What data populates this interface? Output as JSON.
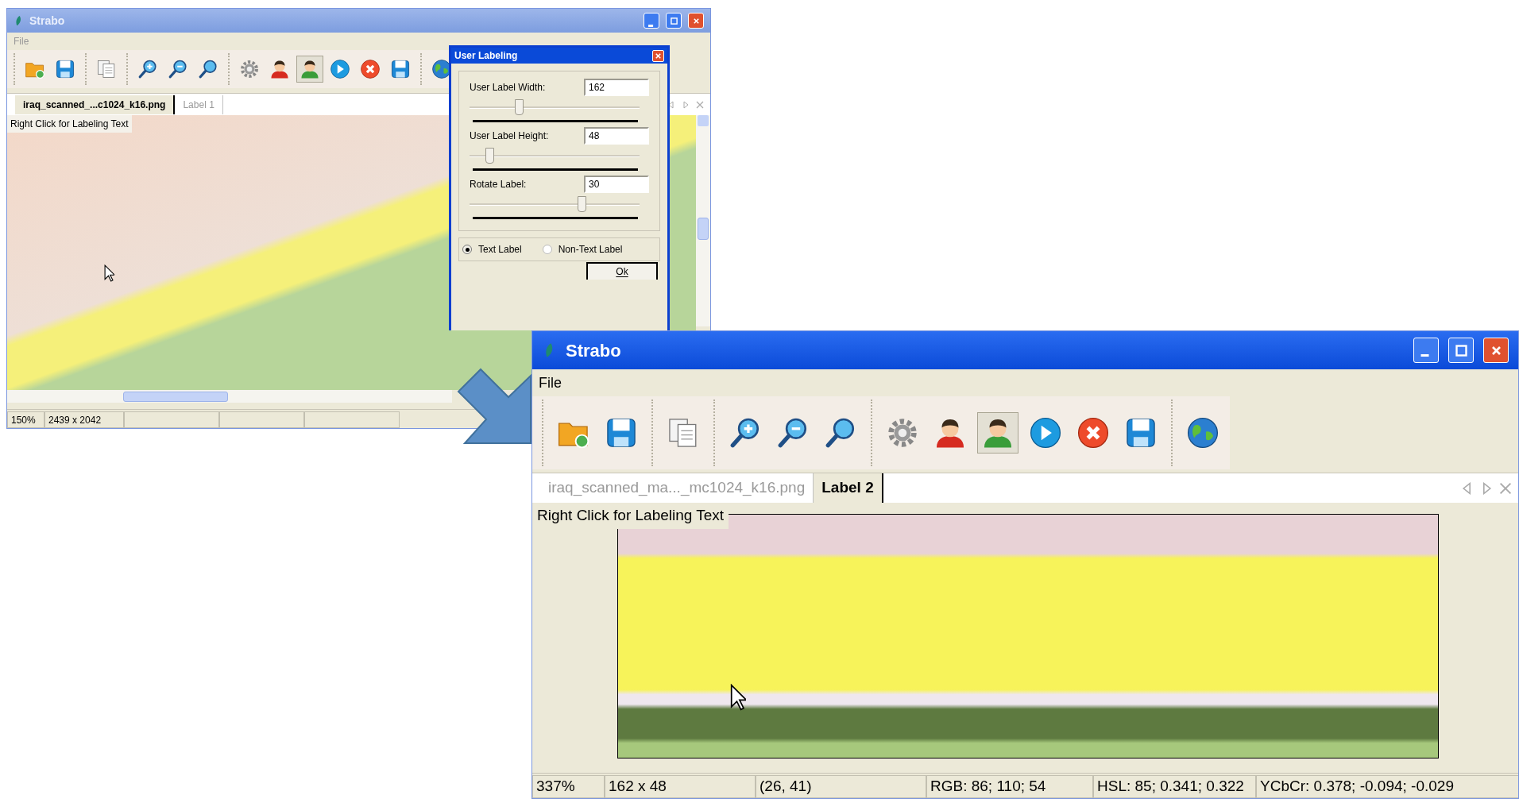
{
  "windows": [
    {
      "title": "Strabo",
      "active": false,
      "menu": [
        "File"
      ],
      "toolbar": [
        [
          {
            "kind": "open",
            "pressed": false
          },
          {
            "kind": "save",
            "pressed": false
          }
        ],
        [
          {
            "kind": "copy",
            "pressed": false
          }
        ],
        [
          {
            "kind": "zoom_in",
            "pressed": false
          },
          {
            "kind": "zoom_out",
            "pressed": false
          },
          {
            "kind": "zoom_fit",
            "pressed": false
          }
        ],
        [
          {
            "kind": "settings",
            "pressed": false
          },
          {
            "kind": "person_red",
            "pressed": false
          },
          {
            "kind": "person_green",
            "pressed": true
          },
          {
            "kind": "play",
            "pressed": false
          },
          {
            "kind": "cancel",
            "pressed": false
          },
          {
            "kind": "save",
            "pressed": false
          }
        ],
        [
          {
            "kind": "globe",
            "pressed": false
          }
        ]
      ],
      "tabs": [
        {
          "label": "iraq_scanned_...c1024_k16.png",
          "selected": true
        },
        {
          "label": "Label 1",
          "selected": false
        }
      ],
      "caption": "Right Click for Labeling Text",
      "status_bar": [
        "150%",
        "2439 x 2042"
      ]
    },
    {
      "title": "Strabo",
      "active": true,
      "menu": [
        "File"
      ],
      "toolbar": [
        [
          {
            "kind": "open",
            "pressed": false
          },
          {
            "kind": "save",
            "pressed": false
          }
        ],
        [
          {
            "kind": "copy",
            "pressed": false
          }
        ],
        [
          {
            "kind": "zoom_in",
            "pressed": false
          },
          {
            "kind": "zoom_out",
            "pressed": false
          },
          {
            "kind": "zoom_fit",
            "pressed": false
          }
        ],
        [
          {
            "kind": "settings",
            "pressed": false
          },
          {
            "kind": "person_red",
            "pressed": false
          },
          {
            "kind": "person_green",
            "pressed": true
          },
          {
            "kind": "play",
            "pressed": false
          },
          {
            "kind": "cancel",
            "pressed": false
          },
          {
            "kind": "save",
            "pressed": false
          }
        ],
        [
          {
            "kind": "globe",
            "pressed": false
          }
        ]
      ],
      "tabs": [
        {
          "label": "iraq_scanned_ma..._mc1024_k16.png",
          "selected": false
        },
        {
          "label": "Label 2",
          "selected": true
        }
      ],
      "caption": "Right Click for Labeling Text",
      "status_bar": [
        "337%",
        "162 x 48",
        "(26, 41)",
        "RGB: 86; 110; 54",
        "HSL: 85; 0.341; 0.322",
        "YCbCr: 0.378; -0.094; -0.029"
      ]
    }
  ],
  "dialog": {
    "title": "User Labeling",
    "fields": [
      {
        "label": "User Label Width:",
        "value": "162",
        "level": 0.28
      },
      {
        "label": "User Label Height:",
        "value": "48",
        "level": 0.1
      },
      {
        "label": "Rotate Label:",
        "value": "30",
        "level": 0.67
      }
    ],
    "options": [
      {
        "label": "Text Label",
        "selected": true
      },
      {
        "label": "Non-Text Label",
        "selected": false
      }
    ],
    "button": "Ok"
  }
}
